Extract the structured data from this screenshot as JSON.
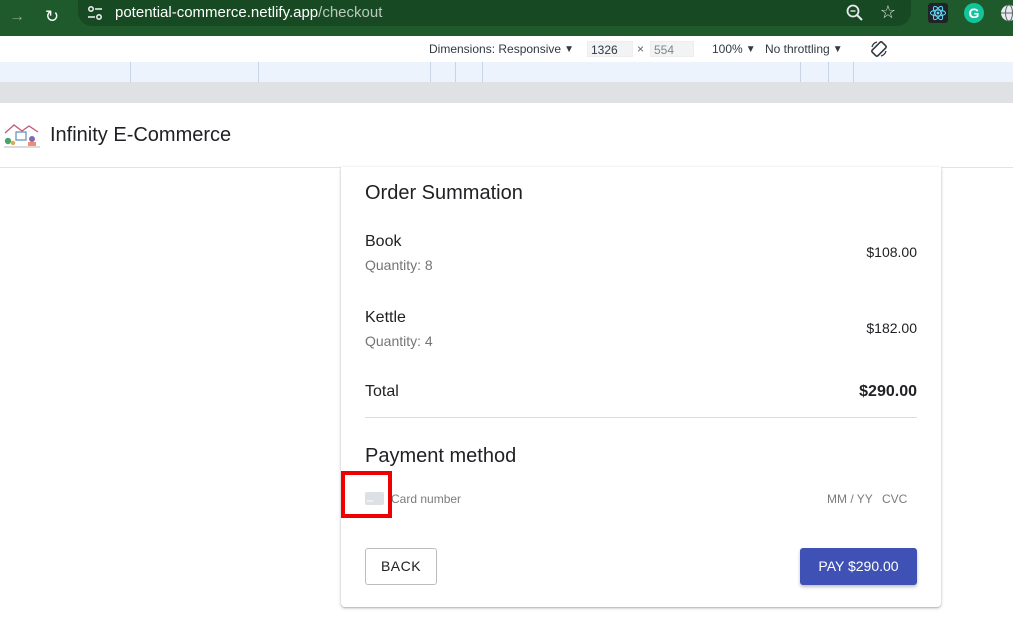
{
  "browser": {
    "url_host": "potential-commerce.netlify.app",
    "url_path": "/checkout",
    "icons": [
      "forward-icon",
      "reload-icon",
      "site-info-icon",
      "zoom-icon",
      "star-icon",
      "react-devtools-icon",
      "grammarly-icon",
      "globe-icon"
    ],
    "colors": {
      "frame": "#1e5a2b",
      "omnibox": "#174923"
    }
  },
  "devtools": {
    "dimensions_label": "Dimensions: Responsive",
    "width_value": "1326",
    "times": "×",
    "height_value": "554",
    "zoom": "100%",
    "throttling": "No throttling"
  },
  "header": {
    "brand": "Infinity E-Commerce"
  },
  "order": {
    "title": "Order Summation",
    "items": [
      {
        "name": "Book",
        "quantity": "Quantity: 8",
        "price": "$108.00"
      },
      {
        "name": "Kettle",
        "quantity": "Quantity: 4",
        "price": "$182.00"
      }
    ],
    "total_label": "Total",
    "total_value": "$290.00"
  },
  "payment": {
    "title": "Payment method",
    "card_placeholder": "Card number",
    "expiry_placeholder": "MM / YY",
    "cvc_placeholder": "CVC"
  },
  "actions": {
    "back": "BACK",
    "pay": "PAY $290.00"
  },
  "colors": {
    "primary": "#3f51b5",
    "highlight": "#ee0000"
  }
}
